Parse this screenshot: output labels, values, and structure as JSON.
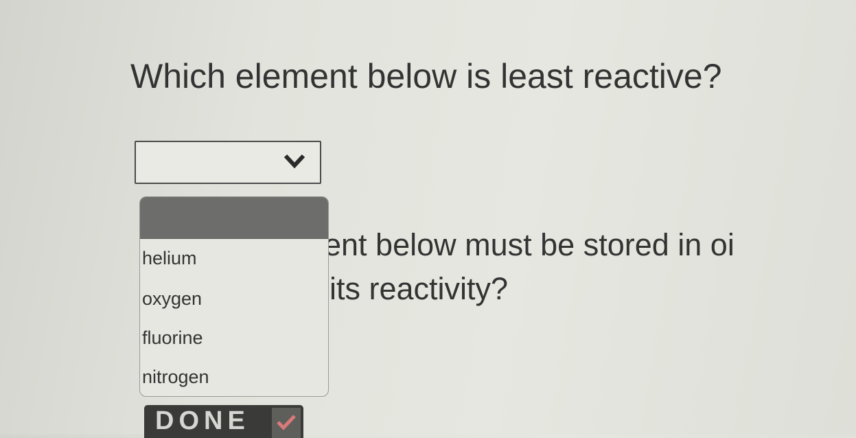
{
  "question_1": {
    "text": "Which element below is least reactive?",
    "selected_value": ""
  },
  "dropdown": {
    "options": [
      "helium",
      "oxygen",
      "fluorine",
      "nitrogen"
    ]
  },
  "question_2": {
    "line_1": "ent below must be stored in oi",
    "line_2": "its reactivity?"
  },
  "done_button": {
    "label": "DONE",
    "icon": "checkmark-icon"
  },
  "colors": {
    "highlight": "#6d6e6b",
    "done_bg": "#3a3b38",
    "check_accent": "#d97a7a"
  }
}
